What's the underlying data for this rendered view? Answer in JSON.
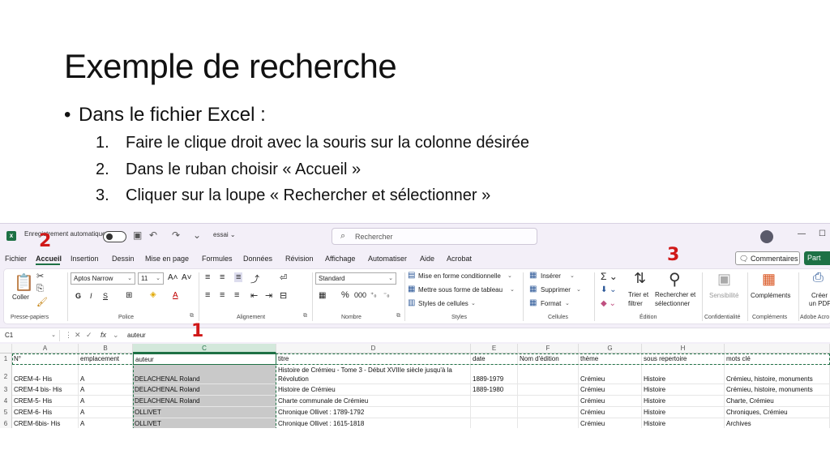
{
  "slide": {
    "title": "Exemple de recherche",
    "bullet": "Dans le fichier Excel :",
    "steps": [
      {
        "num": "1.",
        "text": "Faire le clique droit avec la souris sur la colonne désirée"
      },
      {
        "num": "2.",
        "text": "Dans le ruban choisir « Accueil »"
      },
      {
        "num": "3.",
        "text": "Cliquer sur la loupe « Rechercher et sélectionner »"
      }
    ]
  },
  "annotations": [
    "2",
    "3",
    "1"
  ],
  "excel": {
    "autosave_label": "Enregistrement automatique",
    "file_name": "essai ⌄",
    "search_placeholder": "Rechercher",
    "menu": [
      "Fichier",
      "Accueil",
      "Insertion",
      "Dessin",
      "Mise en page",
      "Formules",
      "Données",
      "Révision",
      "Affichage",
      "Automatiser",
      "Aide",
      "Acrobat"
    ],
    "comments_label": "Commentaires",
    "share_label": "Part",
    "ribbon": {
      "clipboard": {
        "paste": "Coller",
        "label": "Presse-papiers"
      },
      "font": {
        "name": "Aptos Narrow",
        "size": "11",
        "label": "Police"
      },
      "alignment": {
        "label": "Alignement"
      },
      "number": {
        "format": "Standard",
        "label": "Nombre"
      },
      "styles": {
        "items": [
          "Mise en forme conditionnelle",
          "Mettre sous forme de tableau",
          "Styles de cellules"
        ],
        "label": "Styles"
      },
      "cells": {
        "items": [
          "Insérer",
          "Supprimer",
          "Format"
        ],
        "label": "Cellules"
      },
      "editing": {
        "sort": "Trier et filtrer",
        "sort_l1": "Trier et",
        "sort_l2": "filtrer",
        "find_l1": "Rechercher et",
        "find_l2": "sélectionner",
        "label": "Édition"
      },
      "sensitivity": {
        "name": "Sensibilité",
        "label": "Confidentialité"
      },
      "addins": {
        "name": "Compléments",
        "label": "Compléments"
      },
      "acrobat": {
        "l1": "Créer",
        "l2": "un PDF",
        "label": "Adobe Acro"
      }
    },
    "name_box": "C1",
    "formula_value": "auteur",
    "columns": [
      "A",
      "B",
      "C",
      "D",
      "E",
      "F",
      "G",
      "H"
    ],
    "rows": [
      {
        "n": "1",
        "cells": [
          "N°",
          "emplacement",
          "auteur",
          "titre",
          "date",
          "Nom d'édition",
          "thème",
          "sous repertoire",
          "mots clé"
        ]
      },
      {
        "n": "2",
        "cells": [
          "CREM-4- His",
          "A",
          "DELACHENAL Roland",
          "Histoire de  Crémieu - Tome 3 - Début XVIIIe siècle jusqu'à la Révolution",
          "1889-1979",
          "",
          "Crémieu",
          "Histoire",
          "Crémieu, histoire, monuments"
        ]
      },
      {
        "n": "3",
        "cells": [
          "CREM-4 bis- His",
          "A",
          "DELACHENAL Roland",
          "Histoire de Crémieu",
          "1889-1980",
          "",
          "Crémieu",
          "Histoire",
          "Crémieu, histoire, monuments"
        ]
      },
      {
        "n": "4",
        "cells": [
          "CREM-5- His",
          "A",
          "DELACHENAL Roland",
          "Charte communale de Crémieu",
          "",
          "",
          "Crémieu",
          "Histoire",
          "Charte, Crémieu"
        ]
      },
      {
        "n": "5",
        "cells": [
          "CREM-6- His",
          "A",
          "OLLIVET",
          "Chronique Ollivet : 1789-1792",
          "",
          "",
          "Crémieu",
          "Histoire",
          "Chroniques, Crémieu"
        ]
      },
      {
        "n": "6",
        "cells": [
          "CREM-6bis- His",
          "A",
          "OLLIVET",
          "Chronique Ollivet : 1615-1818",
          "",
          "",
          "Crémieu",
          "Histoire",
          "Archives"
        ]
      }
    ],
    "row2_title_l1": "Histoire de  Crémieu - Tome 3 - Début XVIIIe siècle jusqu'à la",
    "row2_title_l2": "Révolution"
  }
}
